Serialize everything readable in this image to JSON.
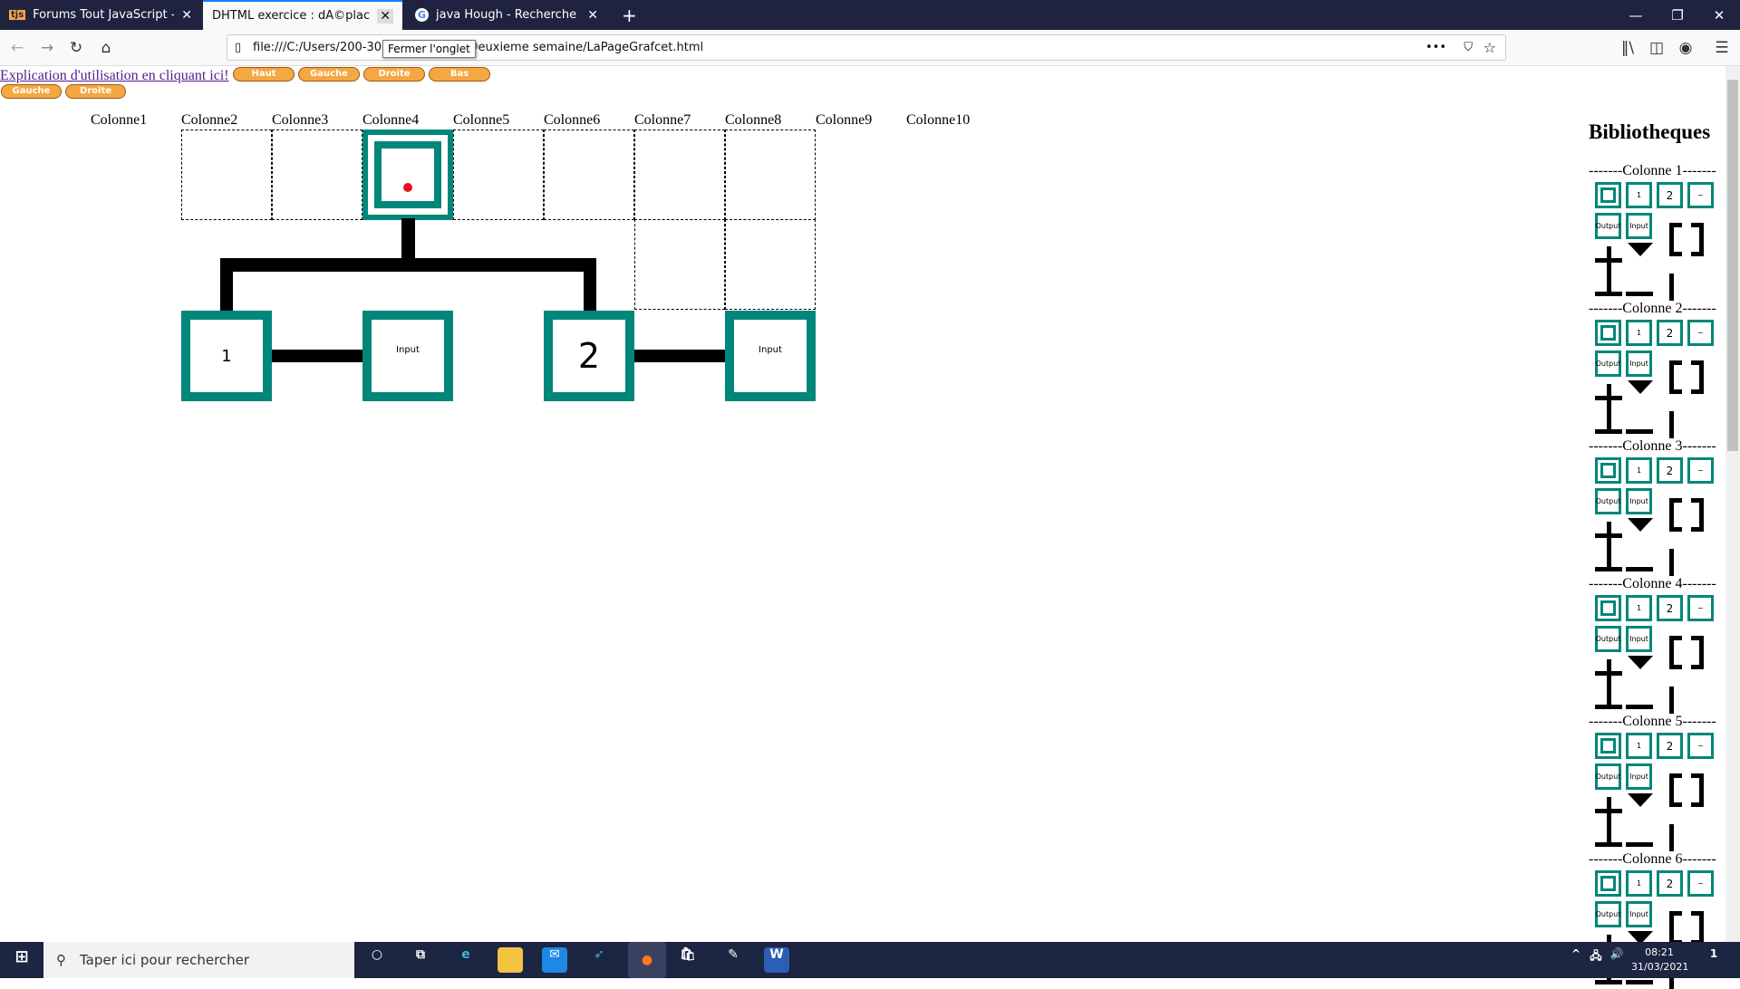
{
  "browser": {
    "tabs": [
      {
        "label": "Forums Tout JavaScript - Écrire",
        "icon": "tjs-icon",
        "active": false
      },
      {
        "label": "DHTML exercice : dÃ©placement d",
        "icon": "",
        "active": true
      },
      {
        "label": "java Hough - Recherche Google",
        "icon": "google-icon",
        "active": false
      }
    ],
    "new_tab": "+",
    "url": "file:///C:/Users/200-300ossier Drazik/Deuxieme semaine/LaPageGrafcet.html",
    "tooltip": "Fermer l'onglet"
  },
  "page": {
    "help_link": "Explication d'utilisation en cliquant ici!",
    "buttons_row1": [
      "Haut",
      "Gauche",
      "Droite",
      "Bas"
    ],
    "buttons_row2": [
      "Gauche",
      "Droite"
    ],
    "button_color": "#f5a742",
    "columns": [
      "Colonne1",
      "Colonne2",
      "Colonne3",
      "Colonne4",
      "Colonne5",
      "Colonne6",
      "Colonne7",
      "Colonne8",
      "Colonne9",
      "Colonne10"
    ],
    "step_color": "#00877a",
    "selected_marker_color": "#e8111b",
    "blocks": {
      "step1": "1",
      "input1": "Input",
      "step2": "2",
      "input2": "Input"
    }
  },
  "sidebar": {
    "title": "Bibliotheques",
    "sections": [
      "-------Colonne 1-------",
      "-------Colonne 2-------",
      "-------Colonne 3-------",
      "-------Colonne 4-------",
      "-------Colonne 5-------",
      "-------Colonne 6-------"
    ],
    "tile_labels": [
      "",
      "1",
      "2",
      "~",
      "Output",
      "Input"
    ]
  },
  "taskbar": {
    "search_placeholder": "Taper ici pour rechercher",
    "time": "08:21",
    "date": "31/03/2021",
    "notifications": "1"
  }
}
